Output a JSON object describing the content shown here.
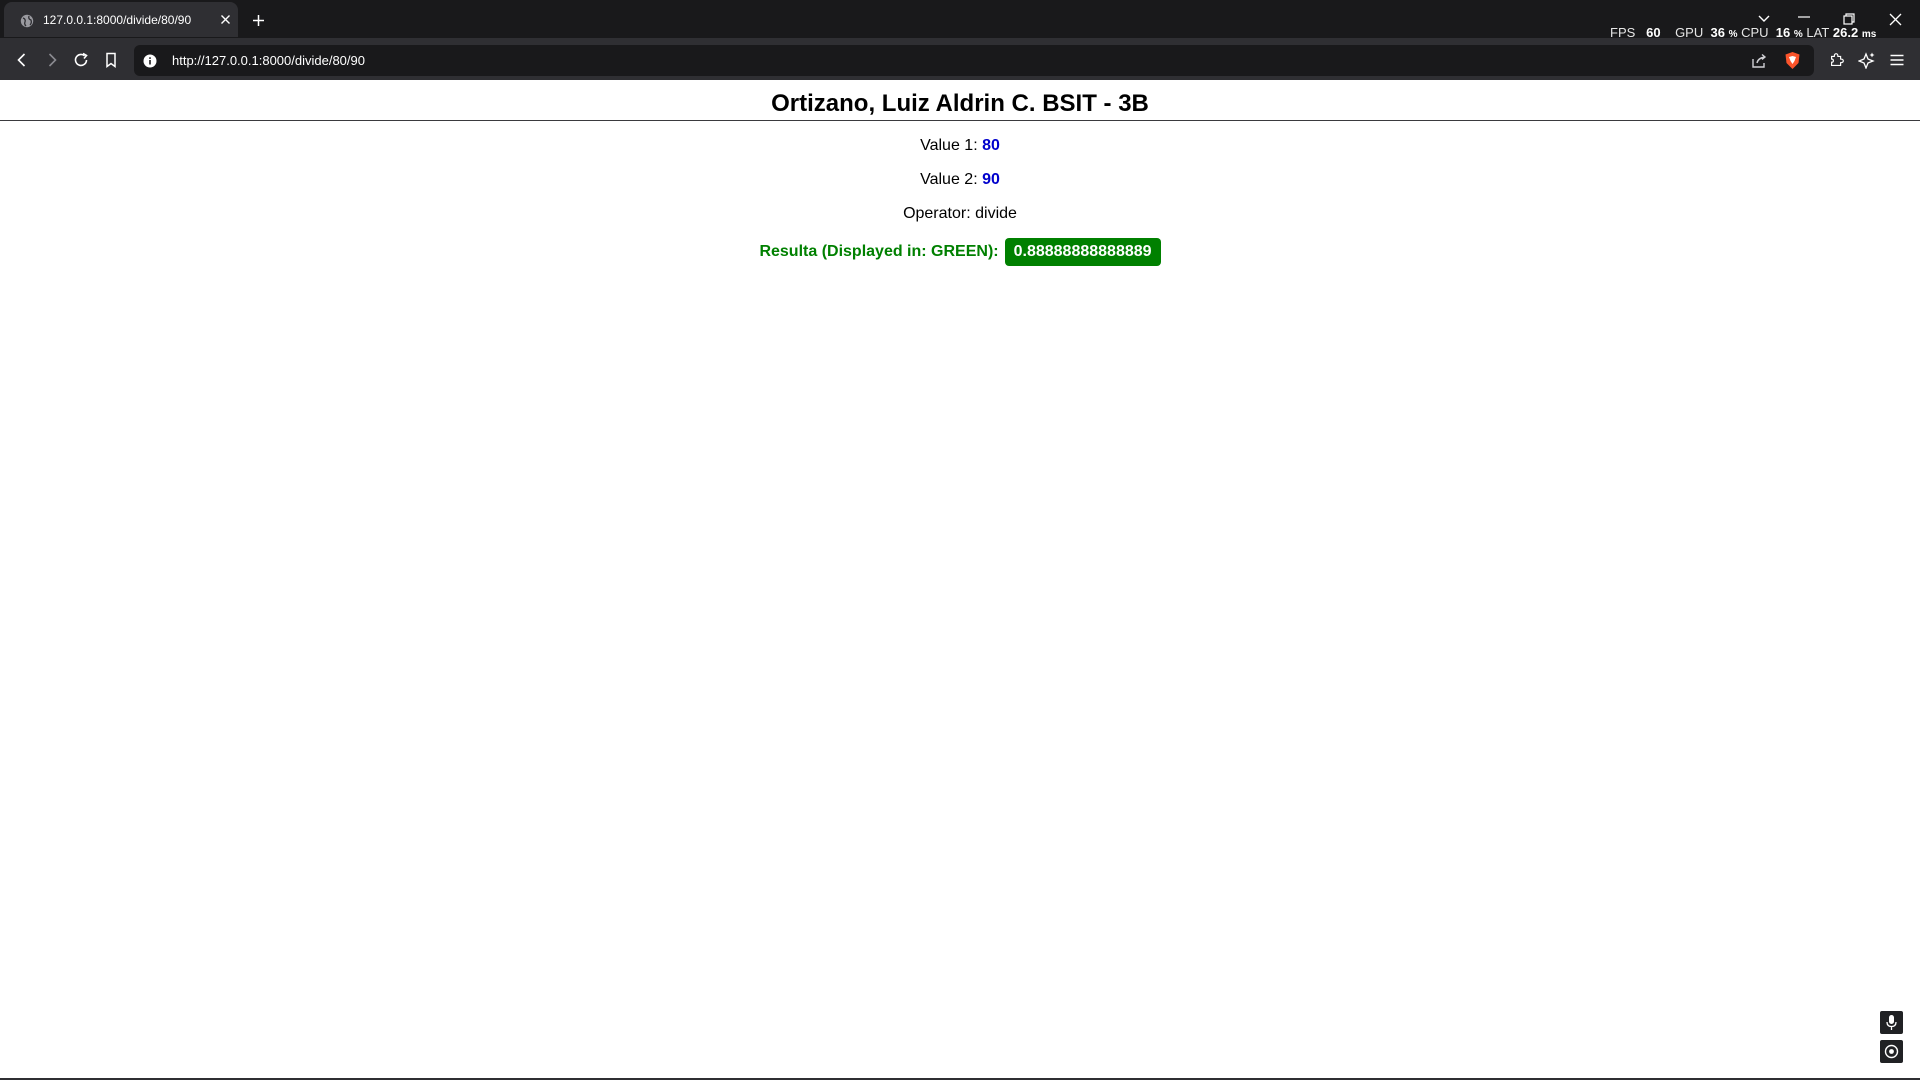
{
  "browser": {
    "tab": {
      "title": "127.0.0.1:8000/divide/80/90"
    },
    "url": "http://127.0.0.1:8000/divide/80/90",
    "perf": {
      "fps_label": "FPS",
      "fps_value": "60",
      "gpu_label": "GPU",
      "gpu_value": "36",
      "gpu_unit": "%",
      "cpu_label": "CPU",
      "cpu_value": "16",
      "cpu_unit": "%",
      "lat_label": "LAT",
      "lat_value": "26.2",
      "lat_unit": "ms"
    },
    "icons": [
      "globe-icon",
      "close-icon",
      "plus-icon",
      "chevron-down-icon",
      "minimize-icon",
      "restore-icon",
      "back-icon",
      "forward-icon",
      "reload-icon",
      "bookmark-icon",
      "info-icon",
      "share-icon",
      "brave-shield-icon",
      "extensions-icon",
      "leo-ai-icon",
      "menu-icon",
      "mic-icon",
      "target-icon"
    ]
  },
  "page": {
    "title": "Ortizano, Luiz Aldrin C. BSIT - 3B",
    "value1_label": "Value 1:",
    "value1": "80",
    "value2_label": "Value 2:",
    "value2": "90",
    "operator_label": "Operator:",
    "operator": "divide",
    "result_label": "Resulta (Displayed in: GREEN):",
    "result": "0.88888888888889"
  },
  "colors": {
    "value_blue": "#0000cc",
    "result_green": "#008000",
    "chrome_dark": "#19191b",
    "chrome_mid": "#2f2f33"
  }
}
